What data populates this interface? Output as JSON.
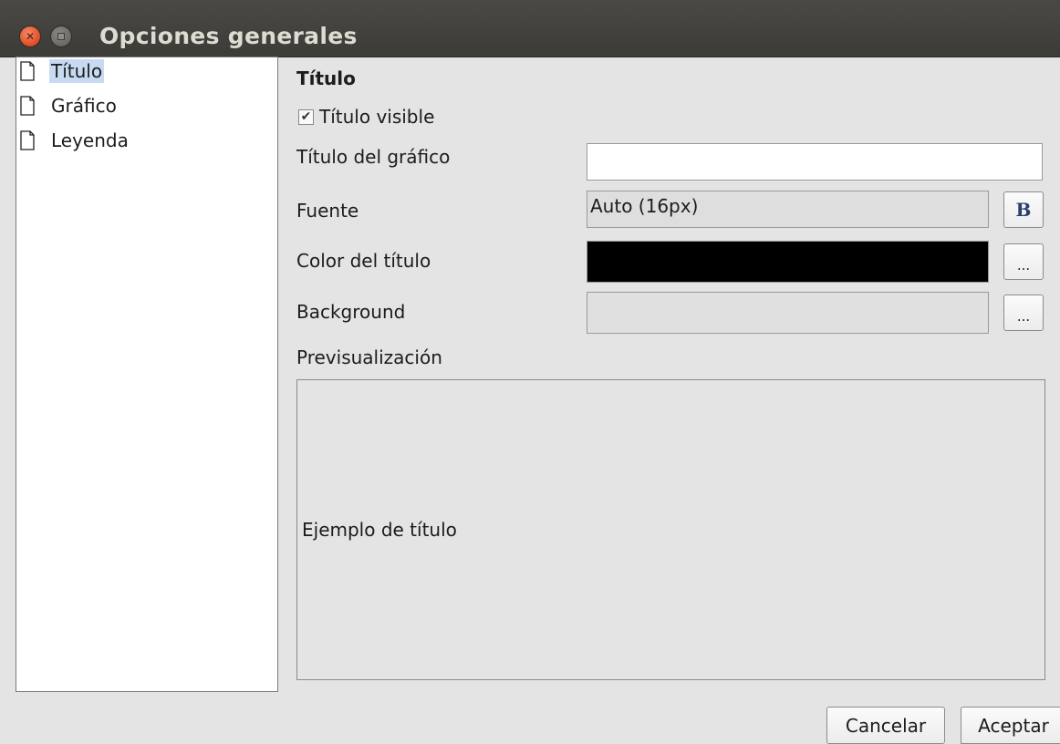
{
  "window": {
    "title": "Opciones generales"
  },
  "tree": {
    "items": [
      {
        "label": "Título",
        "selected": true
      },
      {
        "label": "Gráfico",
        "selected": false
      },
      {
        "label": "Leyenda",
        "selected": false
      }
    ]
  },
  "panel": {
    "section_title": "Título",
    "title_visible": {
      "label": "Título visible",
      "checked": true
    },
    "chart_title": {
      "label": "Título del gráfico",
      "value": ""
    },
    "font": {
      "label": "Fuente",
      "value": "Auto (16px)",
      "bold_button": "B"
    },
    "title_color": {
      "label": "Color del título",
      "color": "#000000",
      "button": "..."
    },
    "background": {
      "label": "Background",
      "color": "#e0e0e0",
      "button": "..."
    },
    "preview": {
      "label": "Previsualización",
      "sample_text": "Ejemplo de título"
    }
  },
  "footer": {
    "cancel": "Cancelar",
    "accept": "Aceptar"
  }
}
